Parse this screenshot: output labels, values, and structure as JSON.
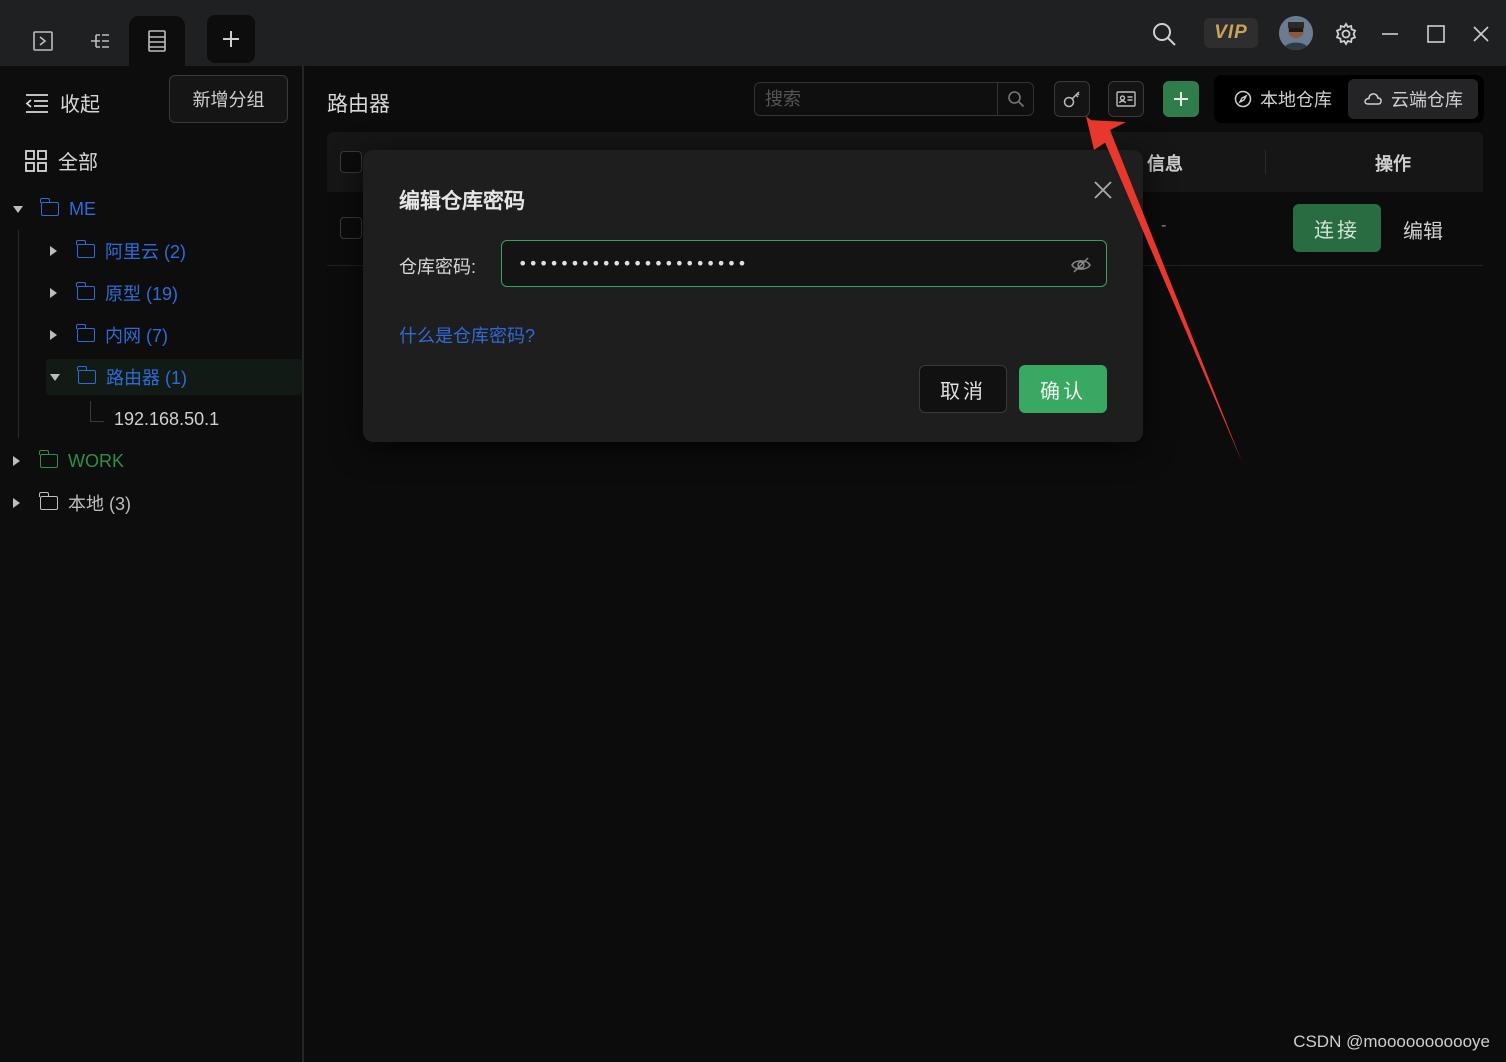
{
  "titlebar": {
    "tabs": [
      {
        "name": "terminal-icon"
      },
      {
        "name": "tree-icon"
      },
      {
        "name": "server-list-icon"
      }
    ],
    "add_tab_icon": "plus-icon",
    "vip_label": "VIP"
  },
  "sidebar": {
    "collapse_label": "收起",
    "new_group_label": "新增分组",
    "all_label": "全部",
    "tree": {
      "me": "ME",
      "aliyun": "阿里云 (2)",
      "prototype": "原型 (19)",
      "intranet": "内网 (7)",
      "router": "路由器 (1)",
      "router_host": "192.168.50.1",
      "work": "WORK",
      "local": "本地 (3)"
    }
  },
  "main": {
    "title": "路由器",
    "search_placeholder": "搜索",
    "store_local": "本地仓库",
    "store_cloud": "云端仓库",
    "table": {
      "headers": {
        "info": "信息",
        "ops": "操作"
      },
      "rows": [
        {
          "info": "-",
          "connect": "连接",
          "edit": "编辑"
        }
      ]
    }
  },
  "modal": {
    "title": "编辑仓库密码",
    "password_label": "仓库密码:",
    "password_value": "••••••••••••••••••••••",
    "help_link": "什么是仓库密码?",
    "cancel": "取消",
    "confirm": "确认"
  },
  "watermark": "CSDN @mooooooooooye",
  "colors": {
    "accent_green": "#38a862",
    "link_blue": "#2f6bd6",
    "annotation_arrow": "#e8372c"
  }
}
